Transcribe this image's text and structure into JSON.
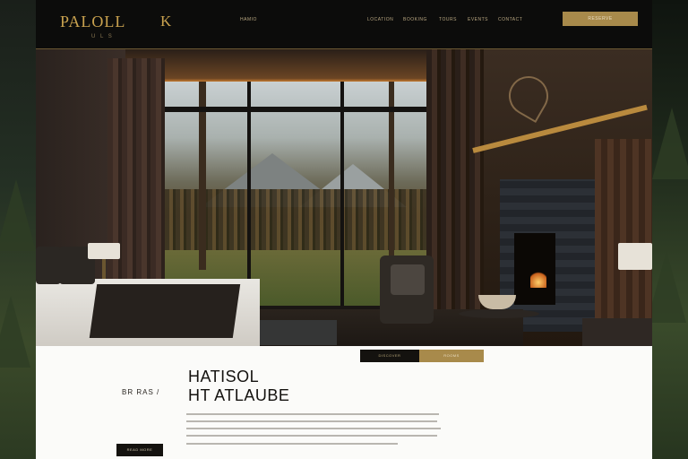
{
  "header": {
    "logo": "PALOLL",
    "logo_sub": "U  L  S",
    "logo_mark": "K",
    "nav": [
      "HAMIO",
      "LOCATION",
      "BOOKING",
      "TOURS",
      "EVENTS",
      "CONTACT"
    ],
    "cta": "RESERVE"
  },
  "hero": {
    "scene": "luxury cabin suite with panoramic forest window"
  },
  "content": {
    "tab_dark": "DISCOVER",
    "tab_gold": "ROOMS",
    "label": "BR  RAS /",
    "title_line1": "HATISOL",
    "title_line2": "HT ATLAUBE",
    "button": "READ MORE"
  },
  "colors": {
    "gold": "#a88a4b",
    "logo_gold": "#c9a24f",
    "dark": "#0c0c0b",
    "light": "#fbfbf9"
  }
}
